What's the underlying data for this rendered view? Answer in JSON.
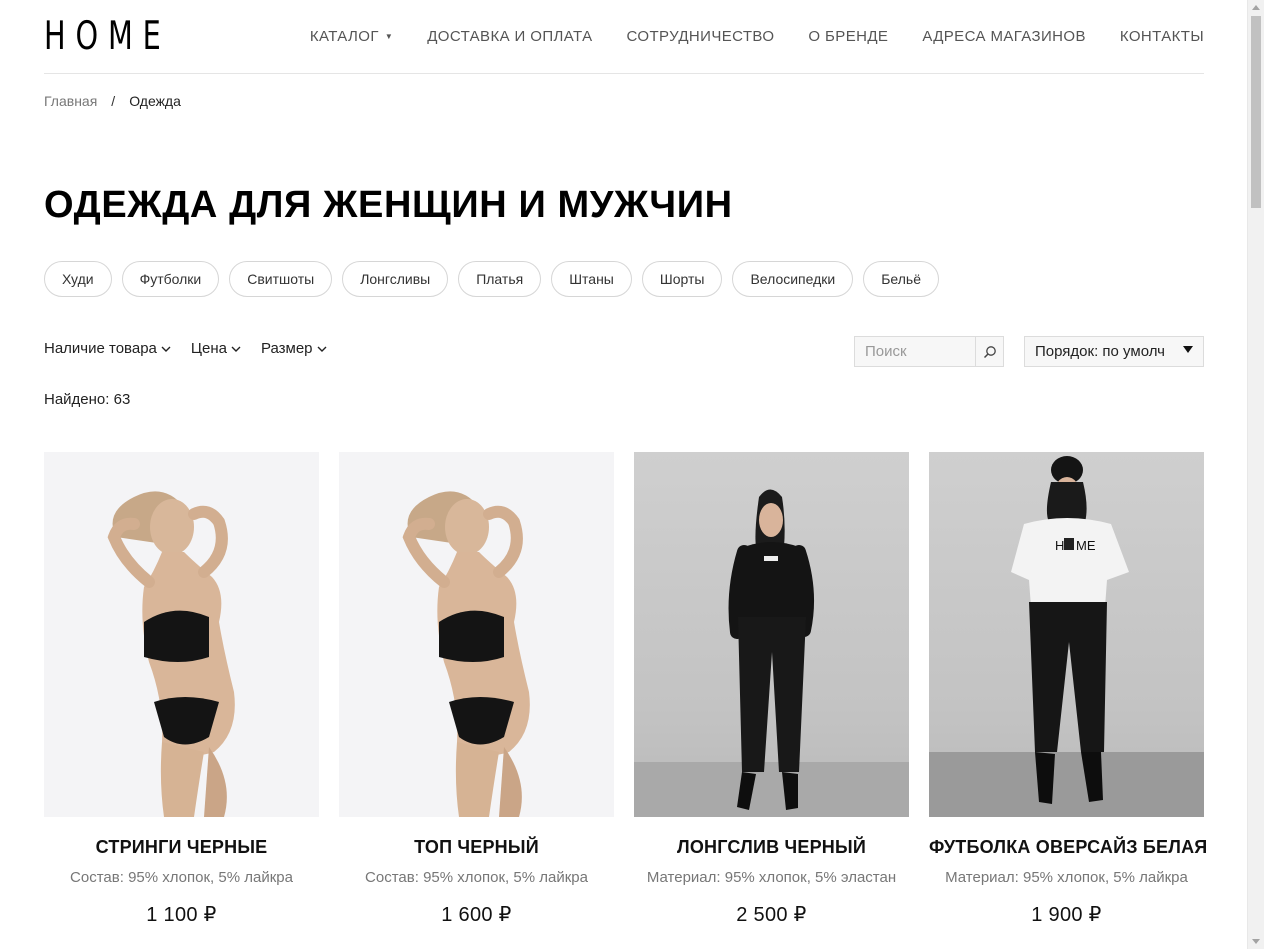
{
  "brand": {
    "logo": "HOME"
  },
  "nav": {
    "items": [
      {
        "label": "КАТАЛОГ"
      },
      {
        "label": "ДОСТАВКА И ОПЛАТА"
      },
      {
        "label": "СОТРУДНИЧЕСТВО"
      },
      {
        "label": "О БРЕНДЕ"
      },
      {
        "label": "АДРЕСА МАГАЗИНОВ"
      },
      {
        "label": "КОНТАКТЫ"
      }
    ]
  },
  "breadcrumb": {
    "home": "Главная",
    "separator": "/",
    "current": "Одежда"
  },
  "page_title": "ОДЕЖДА ДЛЯ ЖЕНЩИН И МУЖЧИН",
  "categories": [
    "Худи",
    "Футболки",
    "Свитшоты",
    "Лонгсливы",
    "Платья",
    "Штаны",
    "Шорты",
    "Велосипедки",
    "Бельё"
  ],
  "filters": {
    "availability": "Наличие товара",
    "price": "Цена",
    "size": "Размер"
  },
  "search": {
    "placeholder": "Поиск",
    "icon": "search-icon"
  },
  "sort": {
    "label": "Порядок: по умолч"
  },
  "found": "Найдено: 63",
  "products": [
    {
      "title": "СТРИНГИ ЧЕРНЫЕ",
      "desc": "Состав: 95% хлопок, 5% лайкра",
      "price": "1 100 ₽"
    },
    {
      "title": "ТОП ЧЕРНЫЙ",
      "desc": "Состав: 95% хлопок, 5% лайкра",
      "price": "1 600 ₽"
    },
    {
      "title": "ЛОНГСЛИВ ЧЕРНЫЙ",
      "desc": "Материал: 95% хлопок, 5% эластан",
      "price": "2 500 ₽"
    },
    {
      "title": "ФУТБОЛКА ОВЕРСАЙЗ БЕЛАЯ",
      "desc": "Материал: 95% хлопок, 5% лайкра",
      "price": "1 900 ₽"
    }
  ],
  "colors": {
    "text": "#000000",
    "muted": "#777777",
    "border": "#d6d6d6"
  }
}
